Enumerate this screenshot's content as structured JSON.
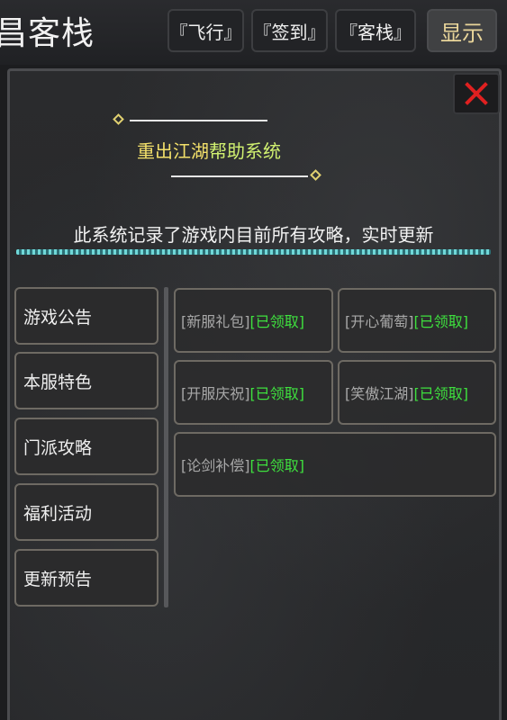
{
  "app_title": "昌客栈",
  "top_buttons": {
    "fly": "『飞行』",
    "checkin": "『签到』",
    "inn": "『客栈』",
    "show": "显示"
  },
  "panel": {
    "close_label": "X",
    "system_title_part1": "重出江湖",
    "system_title_part2": "帮助系统",
    "subtitle": "此系统记录了游戏内目前所有攻略，实时更新"
  },
  "sidebar": {
    "items": [
      {
        "label": "游戏公告"
      },
      {
        "label": "本服特色"
      },
      {
        "label": "门派攻略"
      },
      {
        "label": "福利活动"
      },
      {
        "label": "更新预告"
      }
    ]
  },
  "rewards": [
    {
      "name": "[新服礼包]",
      "status": "[已领取]"
    },
    {
      "name": "[开心葡萄]",
      "status": "[已领取]"
    },
    {
      "name": "[开服庆祝]",
      "status": "[已领取]"
    },
    {
      "name": "[笑傲江湖]",
      "status": "[已领取]"
    },
    {
      "name": "[论剑补偿]",
      "status": "[已领取]"
    }
  ],
  "colors": {
    "claimed_status": "#3ee03e",
    "title_yellow": "#f3e06a",
    "title_green": "#d0f070",
    "close_red": "#e02020"
  }
}
